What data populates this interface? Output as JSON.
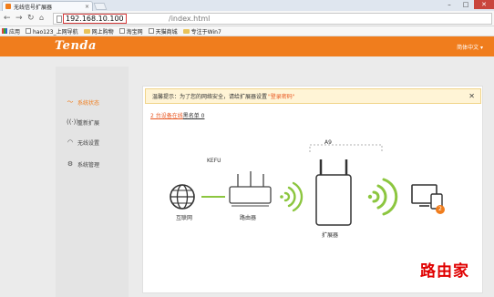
{
  "browser": {
    "tab_title": "无线信号扩展器",
    "url_host": "192.168.10.100",
    "url_path": "/index.html",
    "bookmarks": [
      {
        "label": "应用",
        "icon": "apps-icon"
      },
      {
        "label": "hao123_上网导航",
        "icon": "page-icon"
      },
      {
        "label": "网上购物",
        "icon": "folder-icon"
      },
      {
        "label": "淘宝网",
        "icon": "page-icon"
      },
      {
        "label": "天猫商城",
        "icon": "page-icon"
      },
      {
        "label": "专注于Win7",
        "icon": "folder-icon"
      }
    ]
  },
  "header": {
    "logo": "Tenda",
    "language": "简体中文 ▾",
    "brand_color": "#f07d1d"
  },
  "sidebar": {
    "items": [
      {
        "label": "系统状态",
        "icon": "pulse-icon",
        "active": true
      },
      {
        "label": "重新扩展",
        "icon": "signal-icon",
        "active": false
      },
      {
        "label": "无线设置",
        "icon": "wifi-icon",
        "active": false
      },
      {
        "label": "系统管理",
        "icon": "gears-icon",
        "active": false
      }
    ]
  },
  "notice": {
    "prefix": "温馨提示：为了您的网络安全，请给扩展器设置 ",
    "link": "\"登录密码\"",
    "close": "✕"
  },
  "status": {
    "online_count": "2 台设备在线",
    "blacklist": "黑名单 0"
  },
  "diagram": {
    "internet_label": "互联网",
    "router_name": "KEFU",
    "router_label": "路由器",
    "extender_name": "A9",
    "extender_label": "扩展器",
    "client_count": "2"
  },
  "watermark": "路由家"
}
